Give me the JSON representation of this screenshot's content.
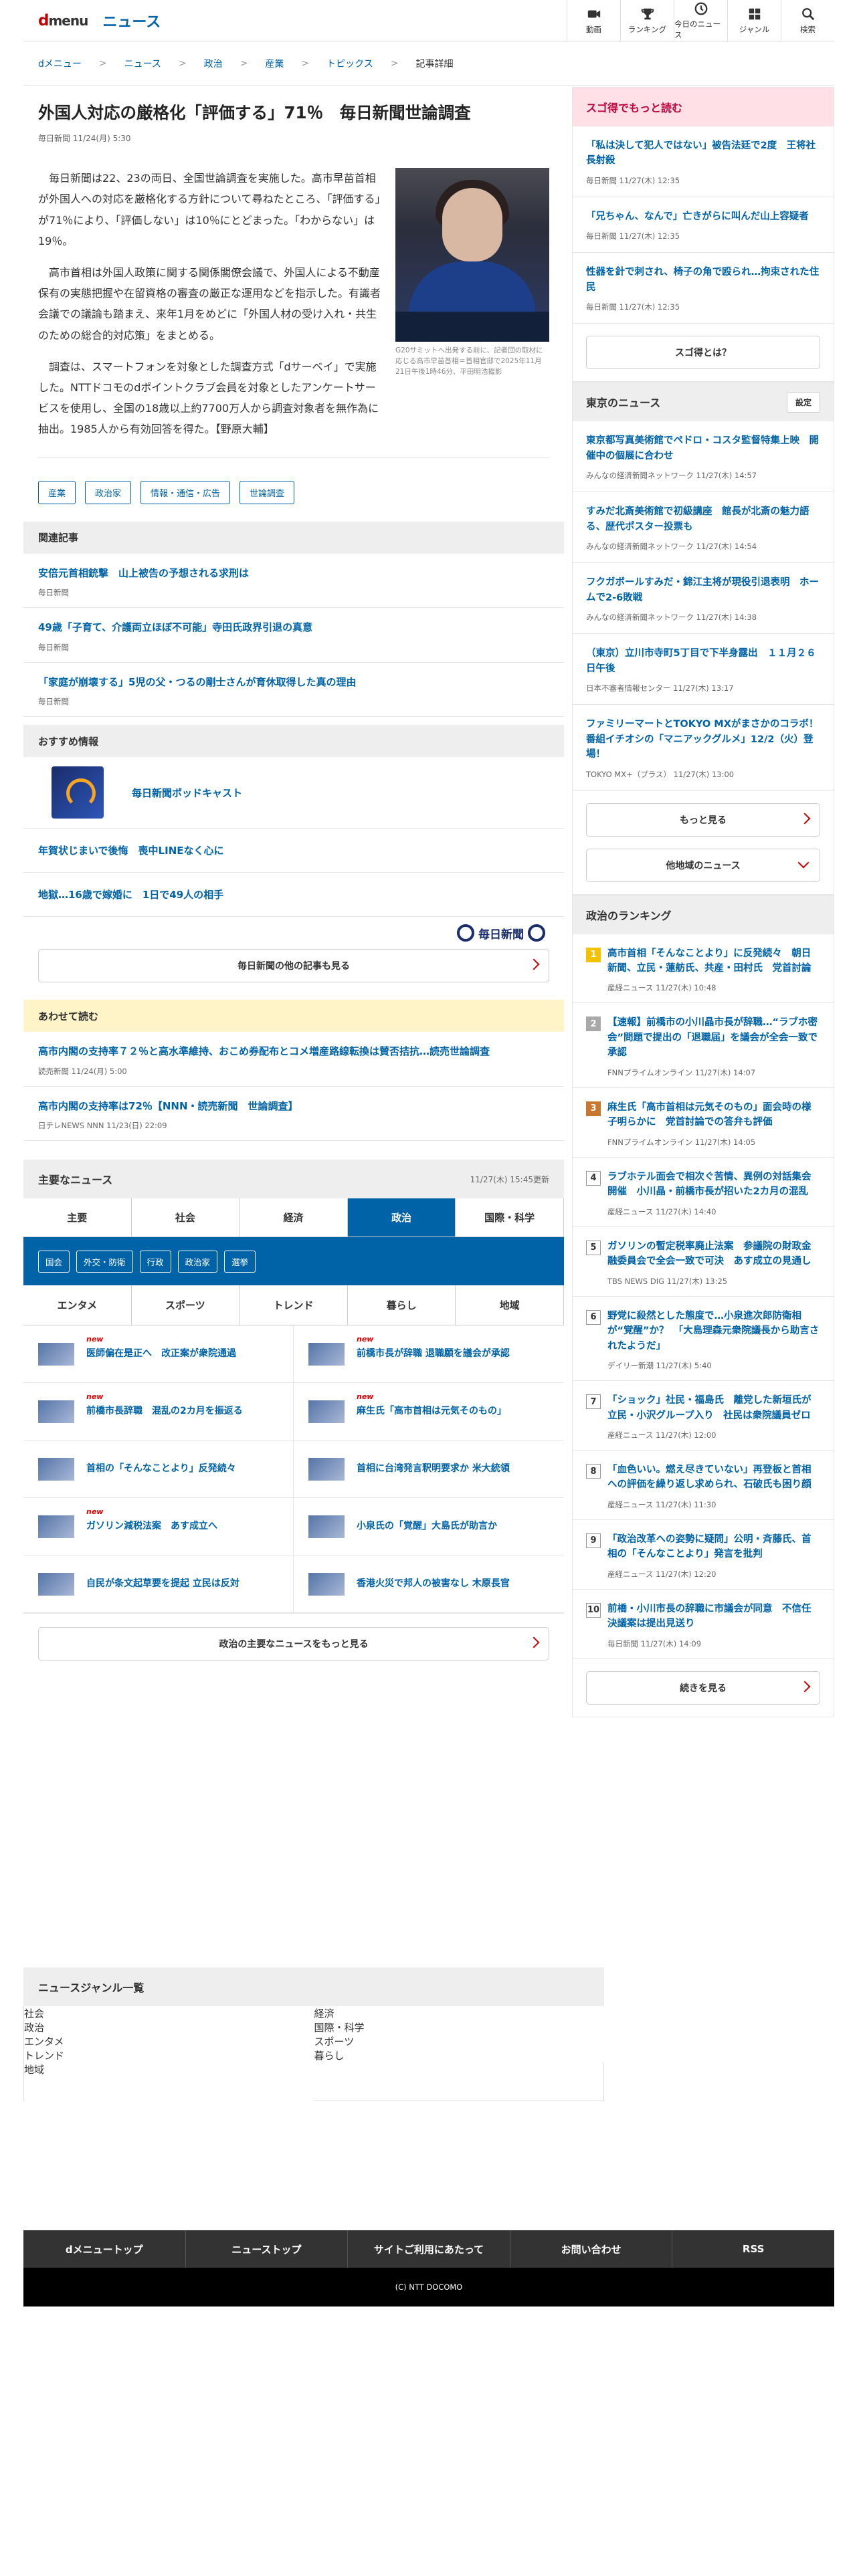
{
  "header": {
    "logo": "d",
    "logo_rest": "menu",
    "site": "ニュース",
    "nav": [
      "動画",
      "ランキング",
      "今日のニュース",
      "ジャンル",
      "検索"
    ]
  },
  "breadcrumb": [
    "dメニュー",
    "ニュース",
    "政治",
    "産業",
    "トピックス",
    "記事詳細"
  ],
  "article": {
    "title": "外国人対応の厳格化「評価する」71％　毎日新聞世論調査",
    "meta": "毎日新聞 11/24(月) 5:30",
    "paragraphs": [
      "毎日新聞は22、23の両日、全国世論調査を実施した。高市早苗首相が外国人への対応を厳格化する方針について尋ねたところ、「評価する」が71％により、「評価しない」は10％にとどまった。「わからない」は19％。",
      "高市首相は外国人政策に関する関係閣僚会議で、外国人による不動産保有の実態把握や在留資格の審査の厳正な運用などを指示した。有識者会議での議論も踏まえ、来年1月をめどに「外国人材の受け入れ・共生のための総合的対応策」をまとめる。",
      "調査は、スマートフォンを対象とした調査方式「dサーベイ」で実施した。NTTドコモのdポイントクラブ会員を対象としたアンケートサービスを使用し、全国の18歳以上約7700万人から調査対象者を無作為に抽出。1985人から有効回答を得た。【野原大輔】"
    ],
    "photo_caption": "G20サミットへ出発する前に、記者団の取材に応じる高市早苗首相＝首相官邸で2025年11月21日午後1時46分、平田明浩撮影",
    "tags": [
      "産業",
      "政治家",
      "情報・通信・広告",
      "世論調査"
    ]
  },
  "related": {
    "heading": "関連記事",
    "items": [
      {
        "title": "安倍元首相銃撃　山上被告の予想される求刑は",
        "source": "毎日新聞"
      },
      {
        "title": "49歳「子育て、介護両立ほぼ不可能」寺田氏政界引退の真意",
        "source": "毎日新聞"
      },
      {
        "title": "「家庭が崩壊する」5児の父・つるの剛士さんが育休取得した真の理由",
        "source": "毎日新聞"
      }
    ]
  },
  "recommend": {
    "heading": "おすすめ情報",
    "podcast": "毎日新聞ポッドキャスト",
    "items": [
      "年賀状じまいで後悔　喪中LINEなく心に",
      "地獄…16歳で嫁婚に　1日で49人の相手"
    ],
    "publisher": "毎日新聞",
    "more": "毎日新聞の他の記事も見る"
  },
  "also": {
    "heading": "あわせて読む",
    "items": [
      {
        "title": "高市内閣の支持率７２％と高水準維持、おこめ券配布とコメ増産路線転換は賛否拮抗…読売世論調査",
        "source": "読売新聞 11/24(月) 5:00"
      },
      {
        "title": "高市内閣の支持率は72％【NNN・読売新聞　世論調査】",
        "source": "日テレNEWS NNN 11/23(日) 22:09"
      }
    ]
  },
  "main_news": {
    "heading": "主要なニュース",
    "updated": "11/27(木) 15:45更新",
    "tabs": [
      "主要",
      "社会",
      "経済",
      "政治",
      "国際・科学"
    ],
    "active_tab": "政治",
    "subtags": [
      "国会",
      "外交・防衛",
      "行政",
      "政治家",
      "選挙"
    ],
    "tabs2": [
      "エンタメ",
      "スポーツ",
      "トレンド",
      "暮らし",
      "地域"
    ],
    "items": [
      {
        "title": "医師偏在是正へ　改正案が衆院通過",
        "new": "new"
      },
      {
        "title": "前橋市長が辞職 退職願を議会が承認",
        "new": "new"
      },
      {
        "title": "前橋市長辞職　混乱の2カ月を振返る",
        "new": "new"
      },
      {
        "title": "麻生氏「高市首相は元気そのもの」",
        "new": "new"
      },
      {
        "title": "首相の「そんなことより」反発続々",
        "new": ""
      },
      {
        "title": "首相に台湾発言釈明要求か 米大統領",
        "new": ""
      },
      {
        "title": "ガソリン減税法案　あす成立へ",
        "new": "new"
      },
      {
        "title": "小泉氏の「覚醒」大島氏が助言か",
        "new": ""
      },
      {
        "title": "自民が条文起草要を提起 立民は反対",
        "new": ""
      },
      {
        "title": "香港火災で邦人の被害なし 木原長官",
        "new": ""
      }
    ],
    "more": "政治の主要なニュースをもっと見る"
  },
  "side_sugo": {
    "heading": "スゴ得でもっと読む",
    "items": [
      {
        "title": "「私は決して犯人ではない」被告法廷で2度　王将社長射殺",
        "source": "毎日新聞 11/27(木) 12:35"
      },
      {
        "title": "「兄ちゃん、なんで」亡きがらに叫んだ山上容疑者",
        "source": "毎日新聞 11/27(木) 12:35"
      },
      {
        "title": "性器を針で刺され、椅子の角で殴られ…拘束された住民",
        "source": "毎日新聞 11/27(木) 12:35"
      }
    ],
    "button": "スゴ得とは？"
  },
  "side_tokyo": {
    "heading": "東京のニュース",
    "setting": "設定",
    "items": [
      {
        "title": "東京都写真美術館でペドロ・コスタ監督特集上映　開催中の個展に合わせ",
        "source": "みんなの経済新聞ネットワーク 11/27(木) 14:57"
      },
      {
        "title": "すみだ北斎美術館で初級講座　館長が北斎の魅力語る、歴代ポスター投票も",
        "source": "みんなの経済新聞ネットワーク 11/27(木) 14:54"
      },
      {
        "title": "フクガボールすみだ・錦江主将が現役引退表明　ホームで2-6敗戦",
        "source": "みんなの経済新聞ネットワーク 11/27(木) 14:38"
      },
      {
        "title": "（東京）立川市寺町5丁目で下半身露出　１１月２６日午後",
        "source": "日本不審者情報センター 11/27(木) 13:17"
      },
      {
        "title": "ファミリーマートとTOKYO MXがまさかのコラボ！番組イチオシの「マニアックグルメ」12/2（火）登場！",
        "source": "TOKYO MX+（プラス） 11/27(木) 13:00"
      }
    ],
    "more": "もっと見る",
    "other": "他地域のニュース"
  },
  "side_rank": {
    "heading": "政治のランキング",
    "items": [
      {
        "n": "1",
        "title": "高市首相「そんなことより」に反発続々　朝日新聞、立民・蓮舫氏、共産・田村氏　党首討論",
        "source": "産経ニュース 11/27(木) 10:48"
      },
      {
        "n": "2",
        "title": "【速報】前橋市の小川晶市長が辞職…“ラブホ密会”問題で提出の「退職届」を議会が全会一致で承認",
        "source": "FNNプライムオンライン 11/27(木) 14:07"
      },
      {
        "n": "3",
        "title": "麻生氏「高市首相は元気そのもの」面会時の様子明らかに　党首討論での答弁も評価",
        "source": "FNNプライムオンライン 11/27(木) 14:05"
      },
      {
        "n": "4",
        "title": "ラブホテル面会で相次ぐ苦情、異例の対話集会開催　小川晶・前橋市長が招いた2カ月の混乱",
        "source": "産経ニュース 11/27(木) 14:40"
      },
      {
        "n": "5",
        "title": "ガソリンの暫定税率廃止法案　参議院の財政金融委員会で全会一致で可決　あす成立の見通し",
        "source": "TBS NEWS DIG 11/27(木) 13:25"
      },
      {
        "n": "6",
        "title": "野党に殺然とした態度で…小泉進次郎防衛相が“覚醒”か？　「大島理森元衆院議長から助言されたようだ」",
        "source": "デイリー新潮 11/27(木) 5:40"
      },
      {
        "n": "7",
        "title": "「ショック」社民・福島氏　離党した新垣氏が立民・小沢グループ入り　社民は衆院議員ゼロ",
        "source": "産経ニュース 11/27(木) 12:00"
      },
      {
        "n": "8",
        "title": "「血色いい。燃え尽きていない」再登板と首相への評価を繰り返し求められ、石破氏も困り顔",
        "source": "産経ニュース 11/27(木) 11:30"
      },
      {
        "n": "9",
        "title": "「政治改革への姿勢に疑問」公明・斉藤氏、首相の「そんなことより」発言を批判",
        "source": "産経ニュース 11/27(木) 12:20"
      },
      {
        "n": "10",
        "title": "前橋・小川市長の辞職に市議会が同意　不信任決議案は提出見送り",
        "source": "毎日新聞 11/27(木) 14:09"
      }
    ],
    "more": "続きを見る"
  },
  "genre": {
    "heading": "ニュースジャンル一覧",
    "items": [
      "社会",
      "経済",
      "政治",
      "国際・科学",
      "エンタメ",
      "スポーツ",
      "トレンド",
      "暮らし",
      "地域",
      ""
    ]
  },
  "footer": {
    "nav": [
      "dメニュートップ",
      "ニューストップ",
      "サイトご利用にあたって",
      "お問い合わせ",
      "RSS"
    ],
    "copyright": "(C) NTT DOCOMO"
  },
  "colors": {
    "accent": "#0063a8",
    "brand": "#c00000",
    "sugo_head": "#ffe0e6",
    "also_head": "#fff4c7"
  }
}
